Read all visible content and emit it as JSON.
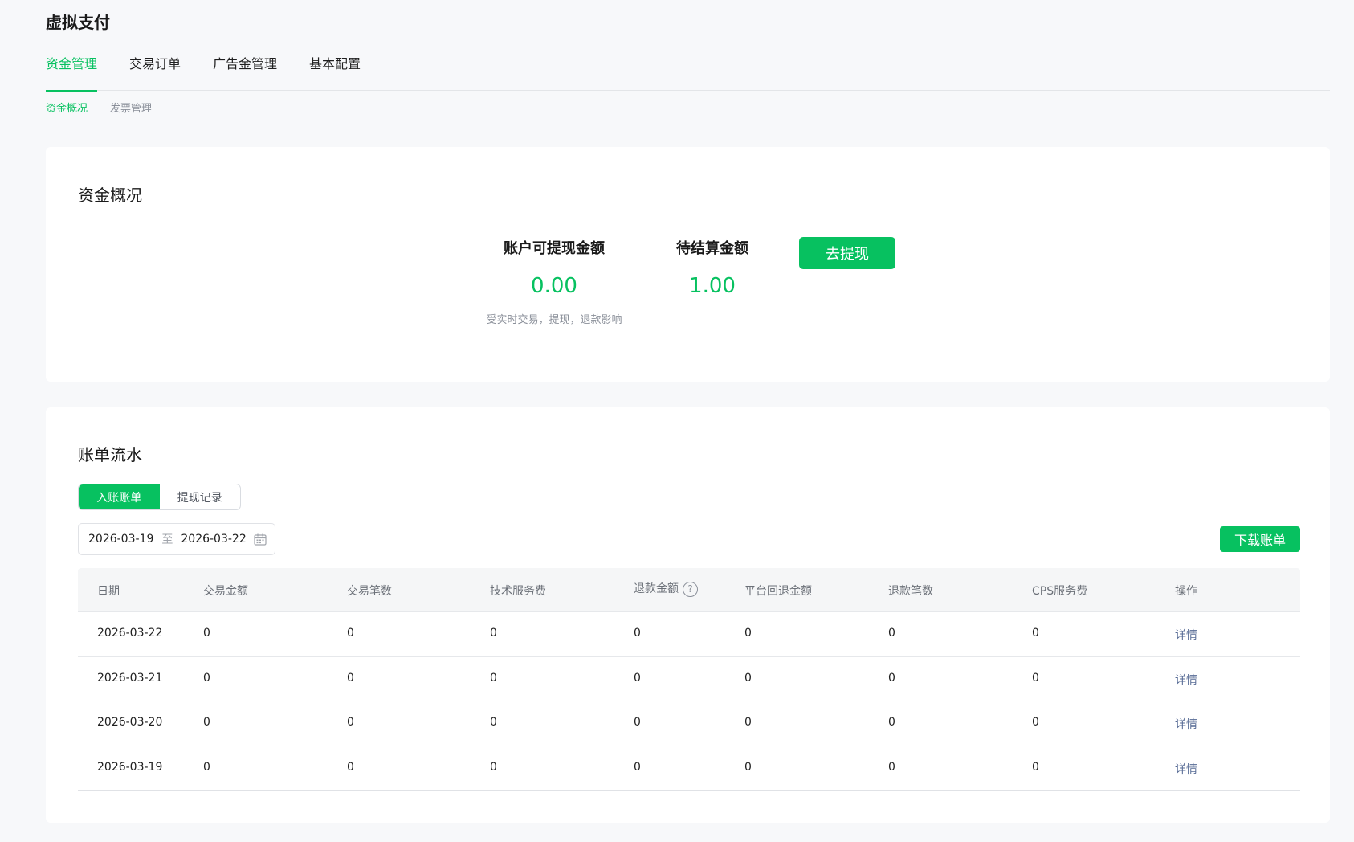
{
  "app": {
    "title": "虚拟支付"
  },
  "main_tabs": [
    {
      "label": "资金管理",
      "active": true
    },
    {
      "label": "交易订单",
      "active": false
    },
    {
      "label": "广告金管理",
      "active": false
    },
    {
      "label": "基本配置",
      "active": false
    }
  ],
  "sub_tabs": [
    {
      "label": "资金概况",
      "active": true
    },
    {
      "label": "发票管理",
      "active": false
    }
  ],
  "overview": {
    "title": "资金概况",
    "withdrawable": {
      "label": "账户可提现金额",
      "value": "0.00",
      "note": "受实时交易，提现，退款影响"
    },
    "pending": {
      "label": "待结算金额",
      "value": "1.00"
    },
    "withdraw_button": "去提现"
  },
  "bill": {
    "title": "账单流水",
    "segments": [
      {
        "label": "入账账单",
        "active": true
      },
      {
        "label": "提现记录",
        "active": false
      }
    ],
    "date_range": {
      "start": "2026-03-19",
      "separator": "至",
      "end": "2026-03-22"
    },
    "download_button": "下载账单",
    "columns": [
      "日期",
      "交易金额",
      "交易笔数",
      "技术服务费",
      "退款金额",
      "平台回退金额",
      "退款笔数",
      "CPS服务费",
      "操作"
    ],
    "rows": [
      {
        "date": "2026-03-22",
        "amount": "0",
        "count": "0",
        "fee": "0",
        "refund": "0",
        "rollback": "0",
        "refund_count": "0",
        "cps": "0",
        "action": "详情"
      },
      {
        "date": "2026-03-21",
        "amount": "0",
        "count": "0",
        "fee": "0",
        "refund": "0",
        "rollback": "0",
        "refund_count": "0",
        "cps": "0",
        "action": "详情"
      },
      {
        "date": "2026-03-20",
        "amount": "0",
        "count": "0",
        "fee": "0",
        "refund": "0",
        "rollback": "0",
        "refund_count": "0",
        "cps": "0",
        "action": "详情"
      },
      {
        "date": "2026-03-19",
        "amount": "0",
        "count": "0",
        "fee": "0",
        "refund": "0",
        "rollback": "0",
        "refund_count": "0",
        "cps": "0",
        "action": "详情"
      }
    ]
  },
  "colors": {
    "accent": "#07c160",
    "link": "#576b95",
    "background": "#f7f8fa"
  },
  "icons": {
    "help": "question-circle-icon",
    "calendar": "calendar-icon"
  }
}
